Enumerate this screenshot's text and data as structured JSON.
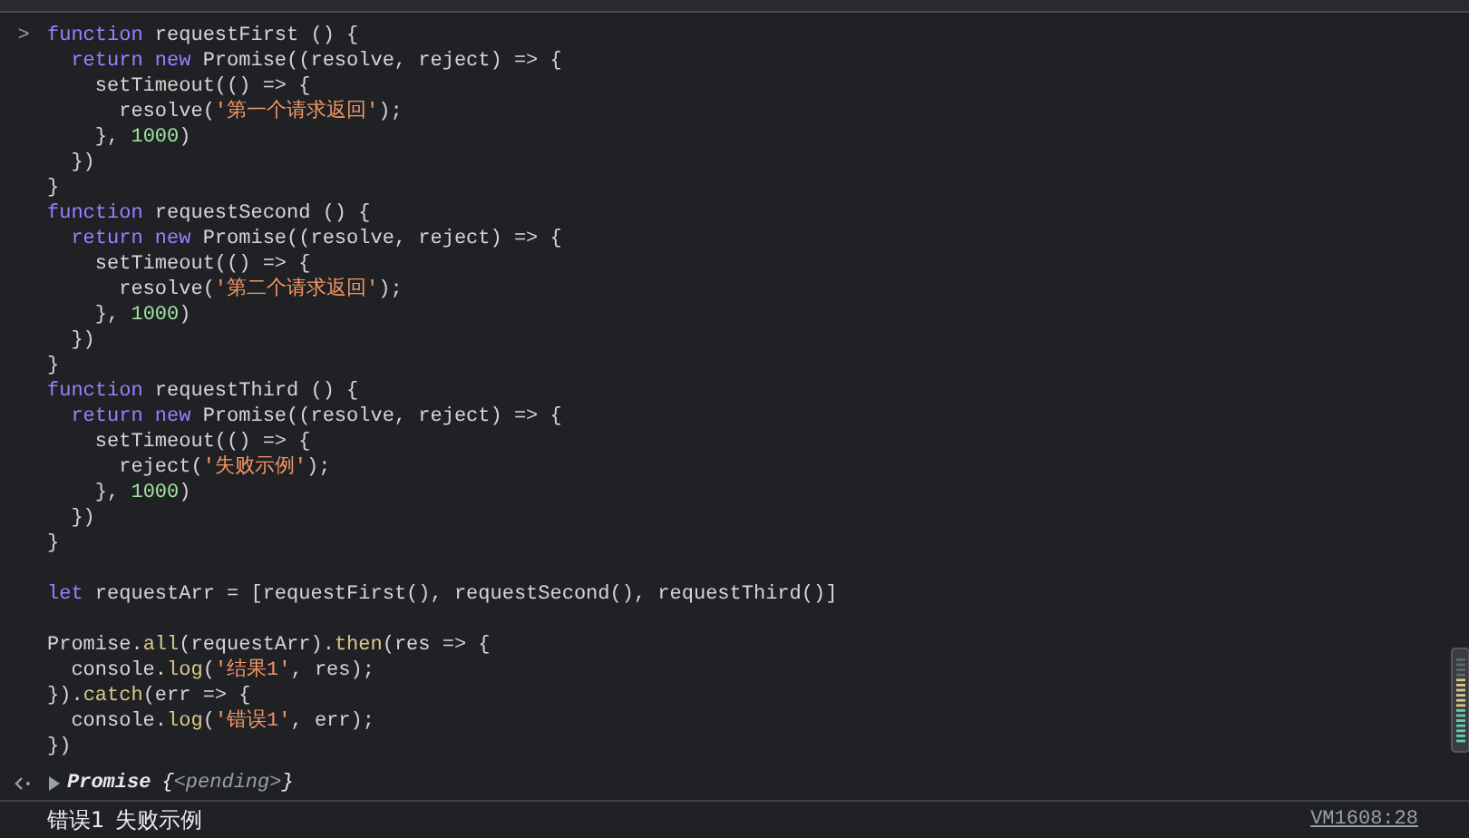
{
  "input": {
    "prompt": ">",
    "lines": [
      {
        "kind": "code",
        "tokens": [
          {
            "text": "function",
            "kind": "keyword"
          },
          {
            "text": " requestFirst () {",
            "kind": "plain"
          }
        ]
      },
      {
        "kind": "code",
        "tokens": [
          {
            "text": "  return new",
            "kind": "keyword"
          },
          {
            "text": " Promise((resolve, reject) => {",
            "kind": "plain"
          }
        ]
      },
      {
        "kind": "code",
        "tokens": [
          {
            "text": "    setTimeout(() => {",
            "kind": "plain"
          }
        ]
      },
      {
        "kind": "code",
        "tokens": [
          {
            "text": "      resolve(",
            "kind": "plain"
          },
          {
            "text": "'第一个请求返回'",
            "kind": "string"
          },
          {
            "text": ");",
            "kind": "plain"
          }
        ]
      },
      {
        "kind": "code",
        "tokens": [
          {
            "text": "    }, ",
            "kind": "plain"
          },
          {
            "text": "1000",
            "kind": "number"
          },
          {
            "text": ")",
            "kind": "plain"
          }
        ]
      },
      {
        "kind": "code",
        "tokens": [
          {
            "text": "  })",
            "kind": "plain"
          }
        ]
      },
      {
        "kind": "code",
        "tokens": [
          {
            "text": "}",
            "kind": "plain"
          }
        ]
      },
      {
        "kind": "code",
        "tokens": [
          {
            "text": "function",
            "kind": "keyword"
          },
          {
            "text": " requestSecond () {",
            "kind": "plain"
          }
        ]
      },
      {
        "kind": "code",
        "tokens": [
          {
            "text": "  return new",
            "kind": "keyword"
          },
          {
            "text": " Promise((resolve, reject) => {",
            "kind": "plain"
          }
        ]
      },
      {
        "kind": "code",
        "tokens": [
          {
            "text": "    setTimeout(() => {",
            "kind": "plain"
          }
        ]
      },
      {
        "kind": "code",
        "tokens": [
          {
            "text": "      resolve(",
            "kind": "plain"
          },
          {
            "text": "'第二个请求返回'",
            "kind": "string"
          },
          {
            "text": ");",
            "kind": "plain"
          }
        ]
      },
      {
        "kind": "code",
        "tokens": [
          {
            "text": "    }, ",
            "kind": "plain"
          },
          {
            "text": "1000",
            "kind": "number"
          },
          {
            "text": ")",
            "kind": "plain"
          }
        ]
      },
      {
        "kind": "code",
        "tokens": [
          {
            "text": "  })",
            "kind": "plain"
          }
        ]
      },
      {
        "kind": "code",
        "tokens": [
          {
            "text": "}",
            "kind": "plain"
          }
        ]
      },
      {
        "kind": "code",
        "tokens": [
          {
            "text": "function",
            "kind": "keyword"
          },
          {
            "text": " requestThird () {",
            "kind": "plain"
          }
        ]
      },
      {
        "kind": "code",
        "tokens": [
          {
            "text": "  return new",
            "kind": "keyword"
          },
          {
            "text": " Promise((resolve, reject) => {",
            "kind": "plain"
          }
        ]
      },
      {
        "kind": "code",
        "tokens": [
          {
            "text": "    setTimeout(() => {",
            "kind": "plain"
          }
        ]
      },
      {
        "kind": "code",
        "tokens": [
          {
            "text": "      reject(",
            "kind": "plain"
          },
          {
            "text": "'失败示例'",
            "kind": "string"
          },
          {
            "text": ");",
            "kind": "plain"
          }
        ]
      },
      {
        "kind": "code",
        "tokens": [
          {
            "text": "    }, ",
            "kind": "plain"
          },
          {
            "text": "1000",
            "kind": "number"
          },
          {
            "text": ")",
            "kind": "plain"
          }
        ]
      },
      {
        "kind": "code",
        "tokens": [
          {
            "text": "  })",
            "kind": "plain"
          }
        ]
      },
      {
        "kind": "code",
        "tokens": [
          {
            "text": "}",
            "kind": "plain"
          }
        ]
      },
      {
        "kind": "blank"
      },
      {
        "kind": "code",
        "tokens": [
          {
            "text": "let",
            "kind": "keyword"
          },
          {
            "text": " requestArr = [requestFirst(), requestSecond(), requestThird()]",
            "kind": "plain"
          }
        ]
      },
      {
        "kind": "blank"
      },
      {
        "kind": "code",
        "tokens": [
          {
            "text": "Promise.",
            "kind": "plain"
          },
          {
            "text": "all",
            "kind": "method"
          },
          {
            "text": "(requestArr).",
            "kind": "plain"
          },
          {
            "text": "then",
            "kind": "method"
          },
          {
            "text": "(res => {",
            "kind": "plain"
          }
        ]
      },
      {
        "kind": "code",
        "tokens": [
          {
            "text": "  console.",
            "kind": "plain"
          },
          {
            "text": "log",
            "kind": "method"
          },
          {
            "text": "(",
            "kind": "plain"
          },
          {
            "text": "'结果1'",
            "kind": "string"
          },
          {
            "text": ", res);",
            "kind": "plain"
          }
        ]
      },
      {
        "kind": "code",
        "tokens": [
          {
            "text": "}).",
            "kind": "plain"
          },
          {
            "text": "catch",
            "kind": "method"
          },
          {
            "text": "(err => {",
            "kind": "plain"
          }
        ]
      },
      {
        "kind": "code",
        "tokens": [
          {
            "text": "  console.",
            "kind": "plain"
          },
          {
            "text": "log",
            "kind": "method"
          },
          {
            "text": "(",
            "kind": "plain"
          },
          {
            "text": "'错误1'",
            "kind": "string"
          },
          {
            "text": ", err);",
            "kind": "plain"
          }
        ]
      },
      {
        "kind": "code",
        "tokens": [
          {
            "text": "})",
            "kind": "plain"
          }
        ]
      }
    ]
  },
  "result": {
    "expanded": false,
    "type": "Promise",
    "open": "{",
    "state": "<pending>",
    "close": "}"
  },
  "log": {
    "args": [
      "错误1",
      "失败示例"
    ],
    "source": "VM1608:28"
  }
}
